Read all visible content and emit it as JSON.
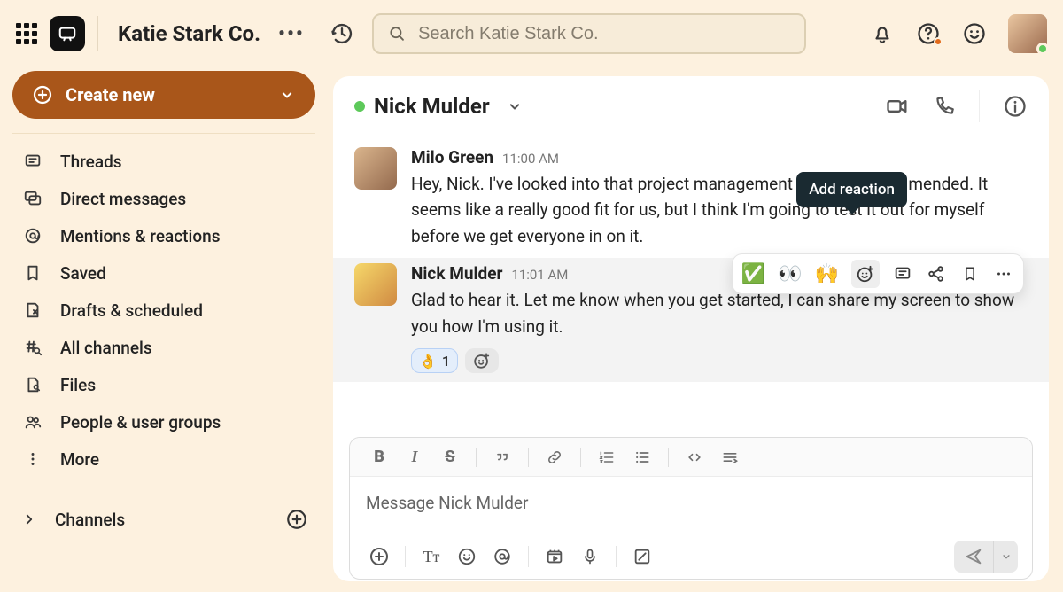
{
  "workspace": {
    "name": "Katie Stark Co."
  },
  "search": {
    "placeholder": "Search Katie Stark Co."
  },
  "sidebar": {
    "create_label": "Create new",
    "items": [
      {
        "icon": "threads-icon",
        "label": "Threads"
      },
      {
        "icon": "dm-icon",
        "label": "Direct messages"
      },
      {
        "icon": "mentions-icon",
        "label": "Mentions & reactions"
      },
      {
        "icon": "bookmark-icon",
        "label": "Saved"
      },
      {
        "icon": "drafts-icon",
        "label": "Drafts & scheduled"
      },
      {
        "icon": "hash-search-icon",
        "label": "All channels"
      },
      {
        "icon": "files-icon",
        "label": "Files"
      },
      {
        "icon": "people-icon",
        "label": "People & user groups"
      },
      {
        "icon": "more-icon",
        "label": "More"
      }
    ],
    "section_channels": "Channels"
  },
  "chat": {
    "title": "Nick Mulder",
    "messages": [
      {
        "author": "Milo Green",
        "time": "11:00 AM",
        "text": "Hey, Nick. I've looked into that project management tool you recommended. It seems like a really good fit for us, but I think I'm going to test it out for myself before we get everyone in on it."
      },
      {
        "author": "Nick Mulder",
        "time": "11:01 AM",
        "text": "Glad to hear it. Let me know when you get started, I can share my screen to show you how I'm using it.",
        "reaction_emoji": "👌",
        "reaction_count": "1"
      }
    ]
  },
  "hover_toolbar": {
    "emoji_check": "✅",
    "emoji_eyes": "👀",
    "emoji_hands": "🙌",
    "tooltip": "Add reaction"
  },
  "composer": {
    "placeholder": "Message Nick Mulder"
  }
}
